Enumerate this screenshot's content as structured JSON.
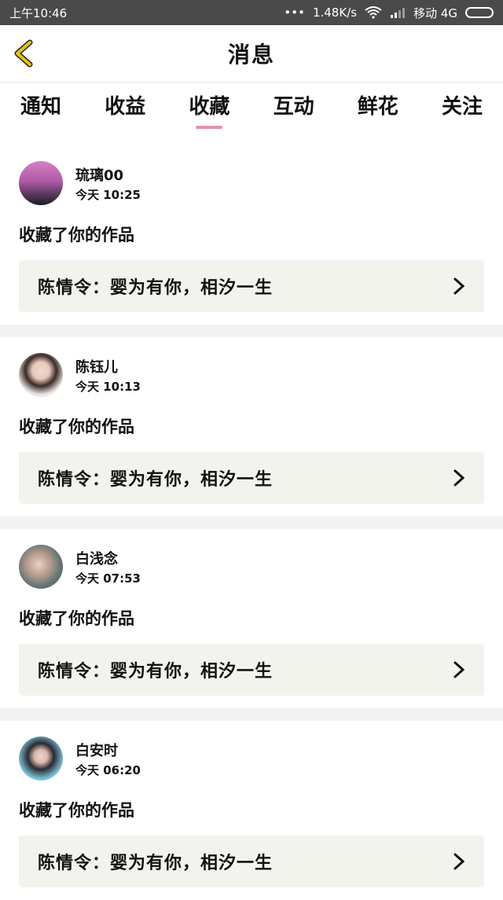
{
  "status_bar": {
    "time": "上午10:46",
    "speed": "1.48K/s",
    "carrier": "移动 4G"
  },
  "header": {
    "title": "消息"
  },
  "tabs": [
    {
      "label": "通知"
    },
    {
      "label": "收益"
    },
    {
      "label": "收藏"
    },
    {
      "label": "互动"
    },
    {
      "label": "鲜花"
    },
    {
      "label": "关注"
    }
  ],
  "active_tab": "收藏",
  "items": [
    {
      "name": "琉璃00",
      "time": "今天 10:25",
      "action": "收藏了你的作品",
      "work": "陈情令：婴为有你，相汐一生"
    },
    {
      "name": "陈钰儿",
      "time": "今天 10:13",
      "action": "收藏了你的作品",
      "work": "陈情令：婴为有你，相汐一生"
    },
    {
      "name": "白浅念",
      "time": "今天 07:53",
      "action": "收藏了你的作品",
      "work": "陈情令：婴为有你，相汐一生"
    },
    {
      "name": "白安时",
      "time": "今天 06:20",
      "action": "收藏了你的作品",
      "work": "陈情令：婴为有你，相汐一生"
    }
  ],
  "colors": {
    "tab_indicator": "#e88db3",
    "work_bg": "#f3f3ee",
    "back_arrow": "#e6c41a"
  }
}
